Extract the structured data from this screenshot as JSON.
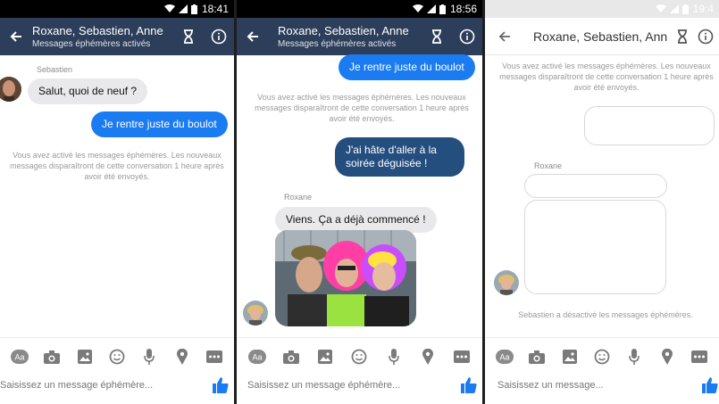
{
  "phones": [
    {
      "status_time": "18:41",
      "header": {
        "title": "Roxane, Sebastien, Anne",
        "subtitle": "Messages éphémères activés"
      },
      "messages": {
        "sender1": "Sebastien",
        "msg1": "Salut, quoi de neuf ?",
        "msg2": "Je rentre juste du boulot",
        "system": "Vous avez activé les messages éphémères. Les nouveaux messages disparaîtront de cette conversation 1 heure après avoir été envoyés."
      },
      "composer_placeholder": "Saisissez un message éphémère..."
    },
    {
      "status_time": "18:56",
      "header": {
        "title": "Roxane, Sebastien, Anne",
        "subtitle": "Messages éphémères activés"
      },
      "messages": {
        "msg_top": "Je rentre juste du boulot",
        "system": "Vous avez activé les messages éphémères. Les nouveaux messages disparaîtront de cette conversation 1 heure après avoir été envoyés.",
        "msg_out": "J'ai hâte d'aller à la soirée déguisée !",
        "sender": "Roxane",
        "msg_in": "Viens. Ça a déjà commencé !"
      },
      "composer_placeholder": "Saisissez un message éphémère..."
    },
    {
      "status_time": "19:4",
      "header": {
        "title": "Roxane, Sebastien, Anne"
      },
      "messages": {
        "system_top": "Vous avez activé les messages éphémères. Les nouveaux messages disparaîtront de cette conversation 1 heure après avoir été envoyés.",
        "sender": "Roxane",
        "system_bottom": "Sebastien a désactivé les messages éphémères."
      },
      "composer_placeholder": "Saisissez un message..."
    }
  ],
  "toolbar": {
    "aa_label": "Aa",
    "icons": [
      "text-format-icon",
      "camera-icon",
      "image-icon",
      "emoji-icon",
      "microphone-icon",
      "location-icon",
      "more-icon"
    ]
  },
  "colors": {
    "header_dark": "#2c3e5a",
    "bubble_out": "#1b7cf2",
    "bubble_in": "#e9e9eb",
    "like": "#1b7cf2"
  }
}
